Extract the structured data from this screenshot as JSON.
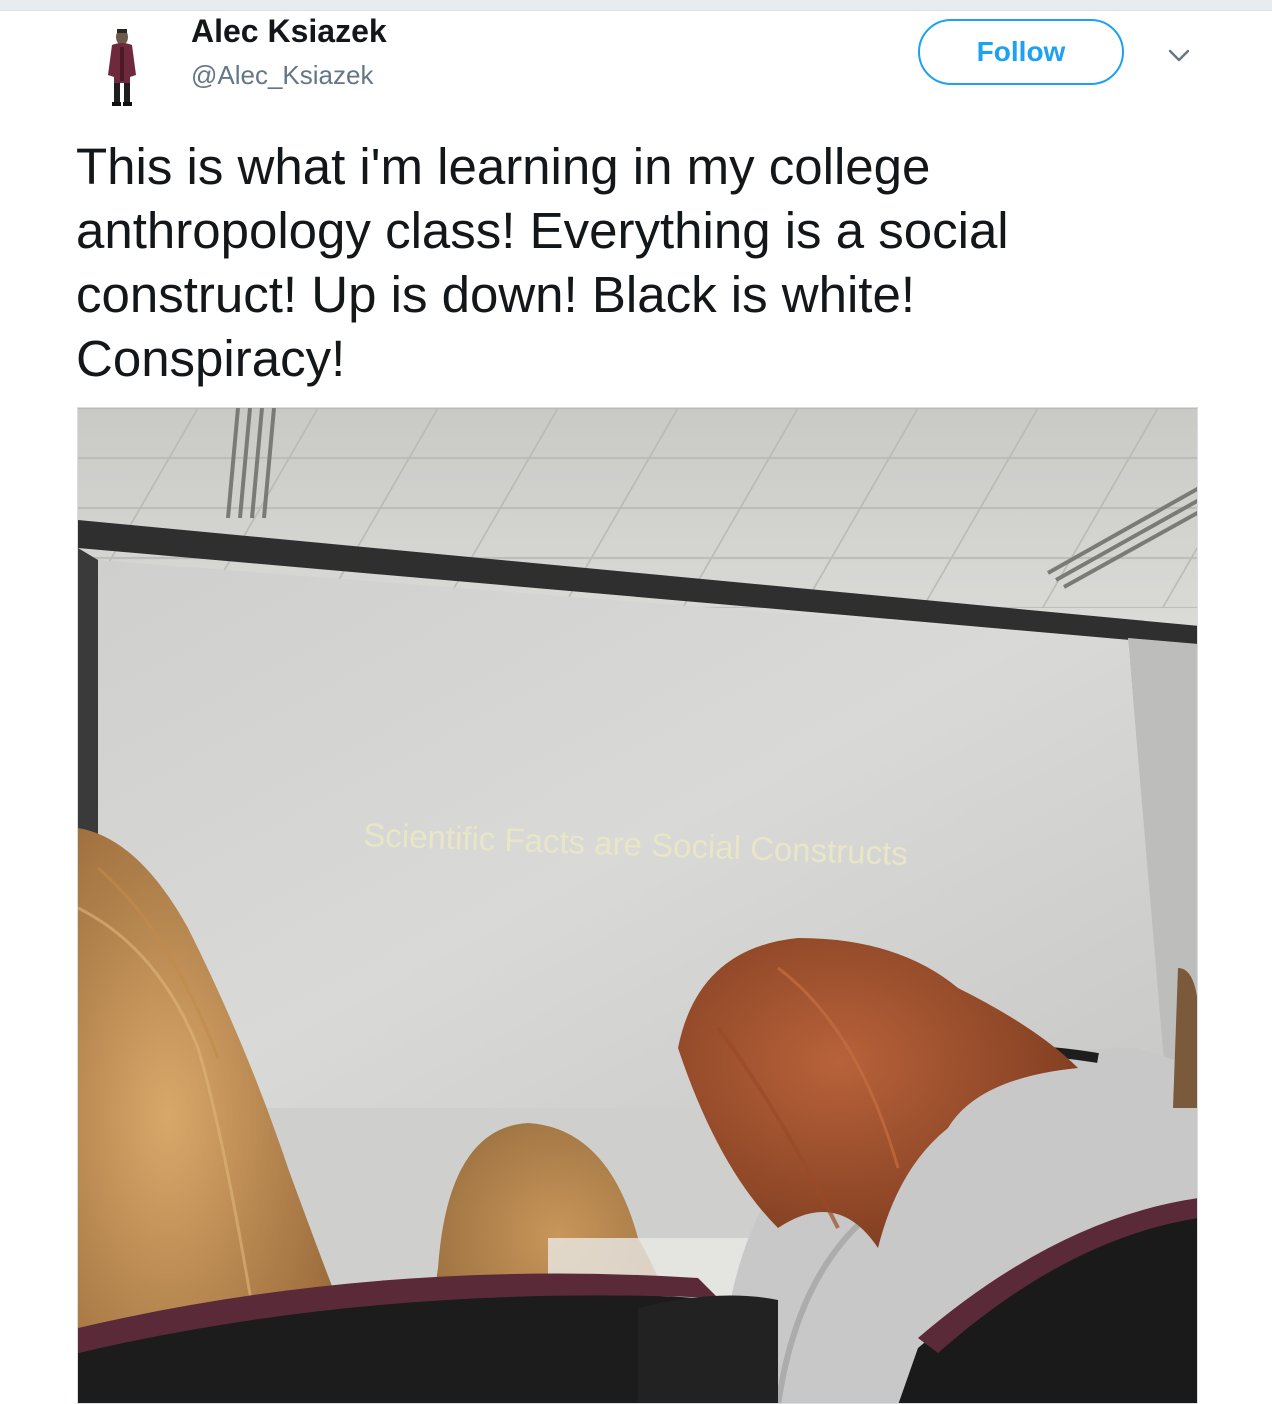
{
  "tweet": {
    "author": {
      "display_name": "Alec Ksiazek",
      "handle": "@Alec_Ksiazek",
      "avatar_icon": "person-avatar-icon"
    },
    "follow_label": "Follow",
    "menu_icon": "chevron-down-icon",
    "text": "This is what i'm learning in my college anthropology class! Everything is a social construct! Up is down! Black is white! Conspiracy!",
    "photo": {
      "slide_text": "Scientific Facts are Social Constructs"
    }
  },
  "colors": {
    "accent": "#1da1f2",
    "text": "#14171a",
    "secondary": "#657786"
  }
}
